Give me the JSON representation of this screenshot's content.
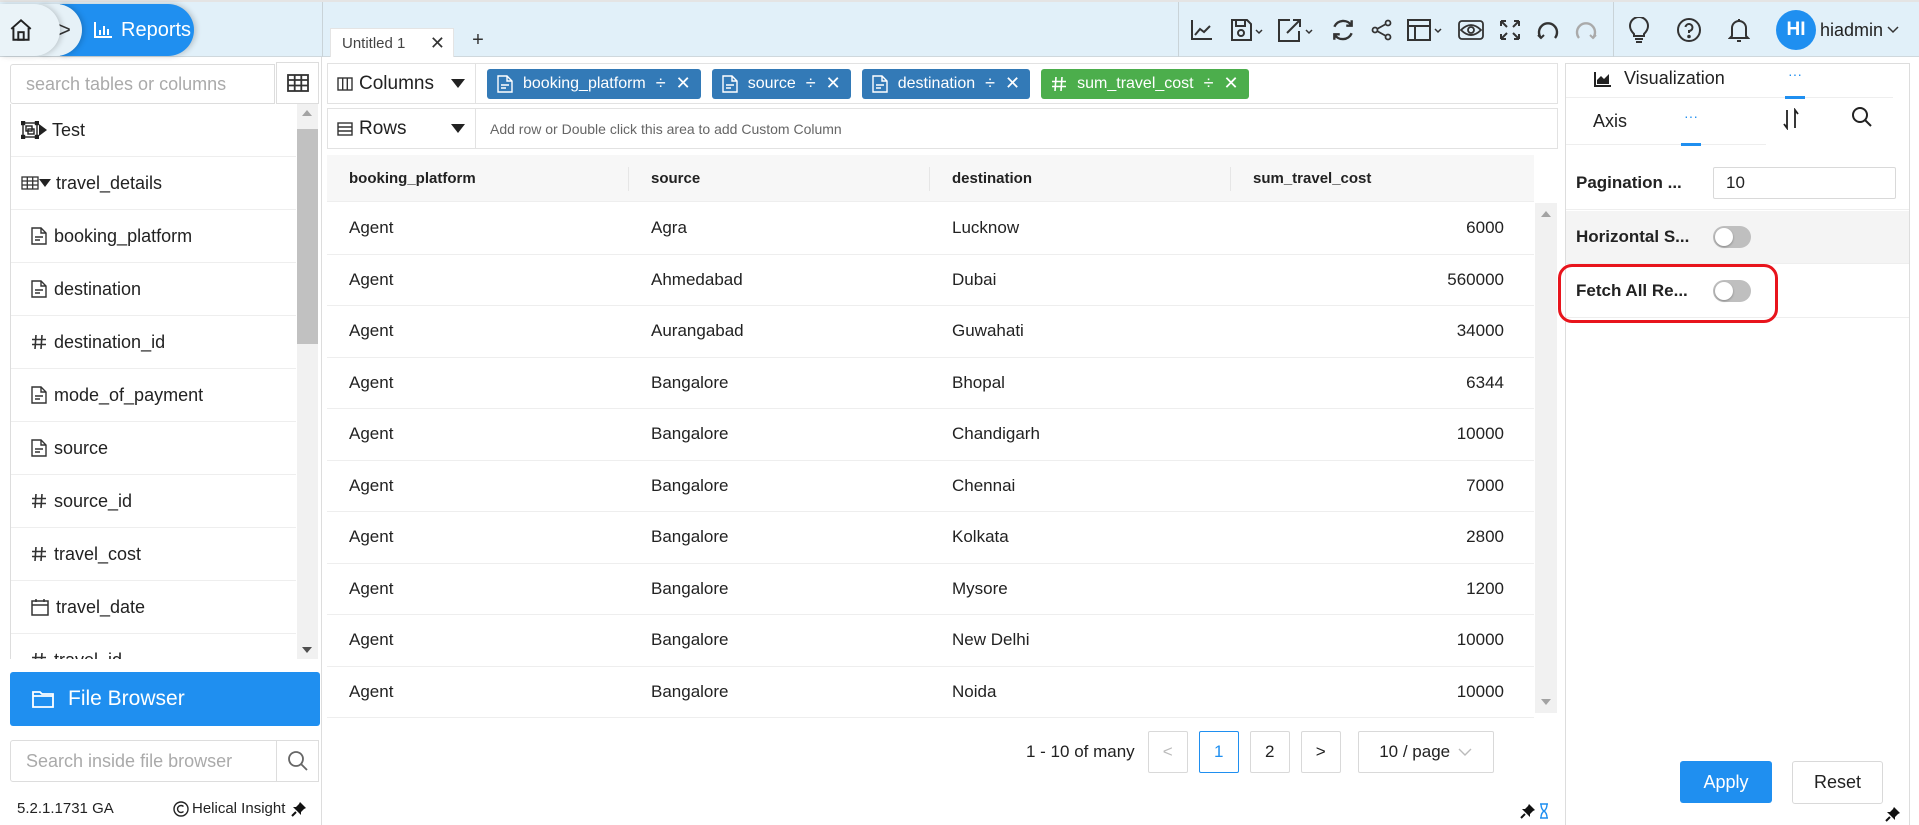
{
  "header": {
    "breadcrumb": {
      "home_icon": "home-icon",
      "separator": ">",
      "current": "Reports",
      "current_icon": "bar-chart-icon"
    },
    "tabs": [
      {
        "label": "Untitled 1",
        "closable": true
      }
    ],
    "add_tab_label": "+",
    "toolbar_icons": [
      "line-chart-icon",
      "save-icon",
      "export-icon",
      "refresh-icon",
      "share-icon",
      "layout-icon",
      "preview-eye-icon",
      "fullscreen-icon",
      "undo-icon",
      "redo-icon",
      "lightbulb-icon",
      "help-icon",
      "bell-icon"
    ],
    "user": {
      "initials": "HI",
      "name": "hiadmin"
    }
  },
  "sidebar": {
    "search_placeholder": "search tables or columns",
    "tree": [
      {
        "label": "Test",
        "icon": "view-icon",
        "expander": "collapsed",
        "level": 0
      },
      {
        "label": "travel_details",
        "icon": "table-icon",
        "expander": "expanded",
        "level": 0
      },
      {
        "label": "booking_platform",
        "icon": "text-field-icon",
        "level": 1
      },
      {
        "label": "destination",
        "icon": "text-field-icon",
        "level": 1
      },
      {
        "label": "destination_id",
        "icon": "number-field-icon",
        "level": 1
      },
      {
        "label": "mode_of_payment",
        "icon": "text-field-icon",
        "level": 1
      },
      {
        "label": "source",
        "icon": "text-field-icon",
        "level": 1
      },
      {
        "label": "source_id",
        "icon": "number-field-icon",
        "level": 1
      },
      {
        "label": "travel_cost",
        "icon": "number-field-icon",
        "level": 1
      },
      {
        "label": "travel_date",
        "icon": "date-field-icon",
        "level": 1
      },
      {
        "label": "travel_id",
        "icon": "number-field-icon",
        "level": 1
      }
    ],
    "file_browser_label": "File Browser",
    "file_browser_search_placeholder": "Search inside file browser",
    "version": "5.2.1.1731 GA",
    "copyright": "Helical Insight"
  },
  "shelves": {
    "columns_label": "Columns",
    "rows_label": "Rows",
    "rows_hint": "Add row or Double click this area to add Custom Column",
    "column_pills": [
      {
        "label": "booking_platform",
        "type": "text",
        "color": "#337ab7"
      },
      {
        "label": "source",
        "type": "text",
        "color": "#337ab7"
      },
      {
        "label": "destination",
        "type": "text",
        "color": "#337ab7"
      },
      {
        "label": "sum_travel_cost",
        "type": "number",
        "color": "#4cae4c"
      }
    ]
  },
  "table": {
    "columns": [
      "booking_platform",
      "source",
      "destination",
      "sum_travel_cost"
    ],
    "rows": [
      [
        "Agent",
        "Agra",
        "Lucknow",
        "6000"
      ],
      [
        "Agent",
        "Ahmedabad",
        "Dubai",
        "560000"
      ],
      [
        "Agent",
        "Aurangabad",
        "Guwahati",
        "34000"
      ],
      [
        "Agent",
        "Bangalore",
        "Bhopal",
        "6344"
      ],
      [
        "Agent",
        "Bangalore",
        "Chandigarh",
        "10000"
      ],
      [
        "Agent",
        "Bangalore",
        "Chennai",
        "7000"
      ],
      [
        "Agent",
        "Bangalore",
        "Kolkata",
        "2800"
      ],
      [
        "Agent",
        "Bangalore",
        "Mysore",
        "1200"
      ],
      [
        "Agent",
        "Bangalore",
        "New Delhi",
        "10000"
      ],
      [
        "Agent",
        "Bangalore",
        "Noida",
        "10000"
      ]
    ]
  },
  "pagination": {
    "summary": "1 - 10 of many",
    "prev": "<",
    "pages": [
      "1",
      "2"
    ],
    "current_page": "1",
    "next": ">",
    "page_size": "10 / page"
  },
  "right_panel": {
    "tab_visualization": "Visualization",
    "tab_more_1": "···",
    "tab_axis": "Axis",
    "tab_more_2": "···",
    "properties": [
      {
        "label": "Pagination ...",
        "type": "input",
        "value": "10"
      },
      {
        "label": "Horizontal S...",
        "type": "toggle",
        "value": false
      },
      {
        "label": "Fetch All Re...",
        "type": "toggle",
        "value": false,
        "highlighted": true
      }
    ],
    "apply_label": "Apply",
    "reset_label": "Reset",
    "highlight_color": "#e8141c"
  },
  "colors": {
    "accent": "#1f8ff0",
    "pill_text": "#337ab7",
    "pill_number": "#4cae4c",
    "topbar_bg": "#e1f0f9"
  }
}
